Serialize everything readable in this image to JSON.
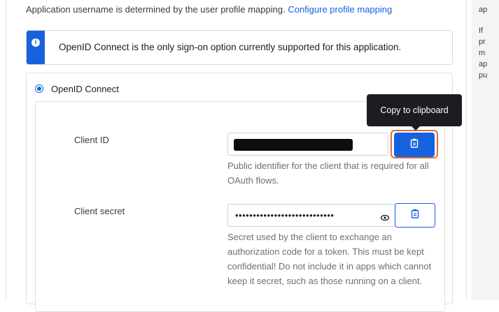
{
  "header": {
    "username_text": "Application username is determined by the user profile mapping.",
    "configure_link": "Configure profile mapping"
  },
  "banner": {
    "info_icon": "i",
    "message": "OpenID Connect is the only sign-on option currently supported for this application."
  },
  "option": {
    "label": "OpenID Connect",
    "selected": true
  },
  "client_id": {
    "label": "Client ID",
    "value_redacted": true,
    "help": "Public identifier for the client that is required for all OAuth flows."
  },
  "client_secret": {
    "label": "Client secret",
    "masked_value": "••••••••••••••••••••••••••••",
    "help": "Secret used by the client to exchange an authorization code for a token. This must be kept confidential! Do not include it in apps which cannot keep it secret, such as those running on a client."
  },
  "tooltip": {
    "text": "Copy to clipboard"
  },
  "right_panel": {
    "lines": [
      "ap",
      "If",
      "pr",
      "m",
      "ap",
      "pu"
    ]
  },
  "colors": {
    "accent": "#1662dd",
    "highlight": "#e36b3c",
    "tooltip_bg": "#1d1d21"
  },
  "icons": {
    "copy": "clipboard-icon",
    "reveal": "eye-icon",
    "info": "info-icon"
  }
}
